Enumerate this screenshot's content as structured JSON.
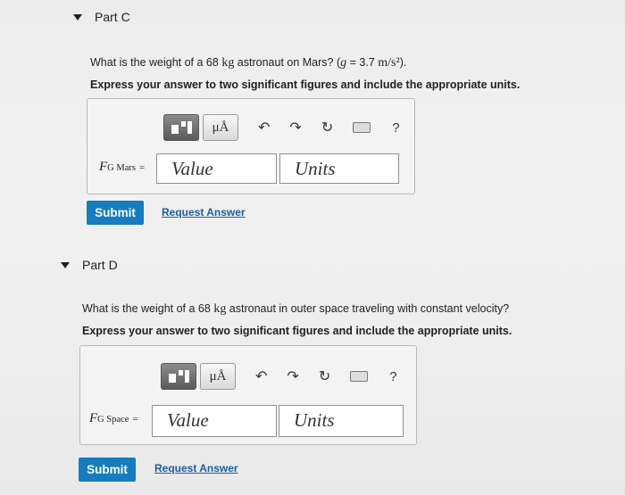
{
  "parts": [
    {
      "header": "Part C",
      "question_pre": "What is the weight of a 68",
      "question_unit": "kg",
      "question_mid": " astronaut on Mars? (",
      "question_g": "g",
      "question_post_g": " = 3.7 ",
      "question_units": "m/s²",
      "question_end": ").",
      "instruction": "Express your answer to two significant figures and include the appropriate units.",
      "toolbar": {
        "mu_label": "μÅ",
        "help_label": "?"
      },
      "label_main": "F",
      "label_sub": "G Mars",
      "label_eq": "=",
      "value_placeholder": "Value",
      "units_placeholder": "Units",
      "submit_label": "Submit",
      "request_label": "Request Answer"
    },
    {
      "header": "Part D",
      "question_pre": "What is the weight of a 68",
      "question_unit": "kg",
      "question_post": " astronaut in outer space traveling with constant velocity?",
      "instruction": "Express your answer to two significant figures and include the appropriate units.",
      "toolbar": {
        "mu_label": "μÅ",
        "help_label": "?"
      },
      "label_main": "F",
      "label_sub": "G Space",
      "label_eq": "=",
      "value_placeholder": "Value",
      "units_placeholder": "Units",
      "submit_label": "Submit",
      "request_label": "Request Answer"
    }
  ],
  "icons": [
    "caret-down-icon",
    "templates-icon",
    "mu-angstrom-icon",
    "undo-icon",
    "redo-icon",
    "reset-icon",
    "keyboard-icon",
    "help-icon"
  ]
}
